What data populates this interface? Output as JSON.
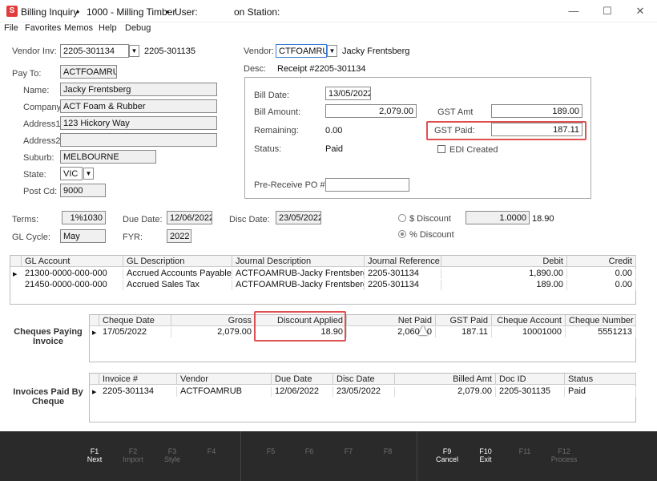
{
  "window": {
    "icon": "S",
    "title": "Billing Inquiry",
    "bullet1": "•",
    "doc": "1000 - Milling Timber",
    "bullet2": "•",
    "user_label": "User:",
    "station_label": "on Station:",
    "minimize": "—",
    "maximize": "☐",
    "close": "✕"
  },
  "menu": [
    "File",
    "Favorites",
    "Memos",
    "Help",
    "Debug"
  ],
  "vendor_inv": {
    "label": "Vendor Inv:",
    "value": "2205-301134",
    "ref": "2205-301135"
  },
  "vendor": {
    "label": "Vendor:",
    "code": "CTFOAMRUB",
    "name": "Jacky Frentsberg"
  },
  "desc": {
    "label": "Desc:",
    "value": "Receipt #2205-301134"
  },
  "pay_to": {
    "label": "Pay To:",
    "code": "ACTFOAMRUB",
    "name_label": "Name:",
    "name": "Jacky Frentsberg",
    "company_label": "Company:",
    "company": "ACT Foam & Rubber",
    "address1_label": "Address1:",
    "address1": "123 Hickory Way",
    "address2_label": "Address2:",
    "address2": "",
    "suburb_label": "Suburb:",
    "suburb": "MELBOURNE",
    "state_label": "State:",
    "state": "VIC",
    "postcode_label": "Post Cd:",
    "postcode": "9000"
  },
  "bill": {
    "date_label": "Bill Date:",
    "date": "13/05/2022",
    "amount_label": "Bill Amount:",
    "amount": "2,079.00",
    "gst_amt_label": "GST Amt",
    "gst_amt": "189.00",
    "remaining_label": "Remaining:",
    "remaining": "0.00",
    "gst_paid_label": "GST Paid:",
    "gst_paid": "187.11",
    "status_label": "Status:",
    "status": "Paid",
    "edi_label": "EDI Created",
    "prereceive_label": "Pre-Receive PO #:",
    "prereceive": ""
  },
  "terms": {
    "terms_label": "Terms:",
    "terms": "1%1030",
    "due_label": "Due Date:",
    "due": "12/06/2022",
    "disc_label": "Disc Date:",
    "disc": "23/05/2022",
    "dollar_discount_label": "$ Discount",
    "discount_value": "1.0000",
    "discount_amount": "18.90",
    "pct_discount_label": "% Discount",
    "gl_cycle_label": "GL Cycle:",
    "gl_cycle": "May",
    "fyr_label": "FYR:",
    "fyr": "2022"
  },
  "gl_grid": {
    "headers": [
      "GL Account",
      "GL Description",
      "Journal Description",
      "Journal Reference",
      "Debit",
      "Credit"
    ],
    "rows": [
      [
        "21300-0000-000-000",
        "Accrued Accounts Payable",
        "ACTFOAMRUB-Jacky Frentsberg",
        "2205-301134",
        "1,890.00",
        "0.00"
      ],
      [
        "21450-0000-000-000",
        "Accrued Sales Tax",
        "ACTFOAMRUB-Jacky Frentsberg",
        "2205-301134",
        "189.00",
        "0.00"
      ]
    ]
  },
  "cheques": {
    "section_label": "Cheques Paying Invoice",
    "headers": [
      "Cheque Date",
      "Gross",
      "Discount Applied",
      "Net Paid",
      "GST Paid",
      "Cheque Account",
      "Cheque Number"
    ],
    "rows": [
      [
        "17/05/2022",
        "2,079.00",
        "18.90",
        "2,060.10",
        "187.11",
        "10001000",
        "5551213"
      ]
    ]
  },
  "invoices": {
    "section_label": "Invoices Paid By Cheque",
    "headers": [
      "Invoice #",
      "Vendor",
      "Due Date",
      "Disc Date",
      "Billed Amt",
      "Doc ID",
      "Status"
    ],
    "rows": [
      [
        "2205-301134",
        "ACTFOAMRUB",
        "12/06/2022",
        "23/05/2022",
        "2,079.00",
        "2205-301135",
        "Paid"
      ]
    ]
  },
  "fkeys": [
    {
      "key": "F1",
      "label": "Next",
      "on": true
    },
    {
      "key": "F2",
      "label": "Import",
      "on": false
    },
    {
      "key": "F3",
      "label": "Style",
      "on": false
    },
    {
      "key": "F4",
      "label": "",
      "on": false
    },
    {
      "key": "F5",
      "label": "",
      "on": false
    },
    {
      "key": "F6",
      "label": "",
      "on": false
    },
    {
      "key": "F7",
      "label": "",
      "on": false
    },
    {
      "key": "F8",
      "label": "",
      "on": false
    },
    {
      "key": "F9",
      "label": "Cancel",
      "on": true
    },
    {
      "key": "F10",
      "label": "Exit",
      "on": true
    },
    {
      "key": "F11",
      "label": "",
      "on": false
    },
    {
      "key": "F12",
      "label": "Process",
      "on": false
    }
  ],
  "colors": {
    "highlight": "#e05050",
    "fbar": "#2a2a2a",
    "app_icon": "#e23b3b"
  }
}
